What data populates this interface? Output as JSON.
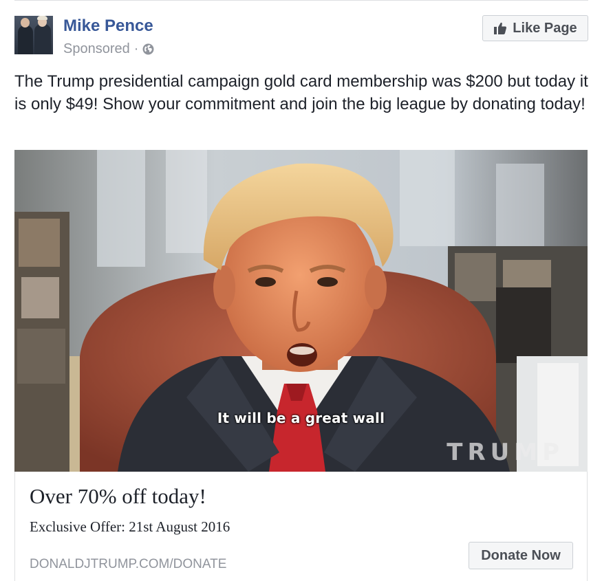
{
  "post": {
    "page_name": "Mike Pence",
    "sponsored_label": "Sponsored",
    "separator": "·",
    "like_button_label": "Like Page",
    "text": "The Trump presidential campaign gold card membership was $200 but today it is only $49! Show your commitment and join the big league by donating today!"
  },
  "media": {
    "caption": "It will be a great wall",
    "watermark": "TRUMP"
  },
  "link_preview": {
    "headline": "Over 70% off today!",
    "subline": "Exclusive Offer: 21st August 2016",
    "domain": "DONALDJTRUMP.COM/DONATE",
    "cta_label": "Donate Now"
  },
  "icons": {
    "visibility": "globe-icon",
    "like": "thumbs-up-icon"
  },
  "colors": {
    "name_link": "#385898",
    "meta_text": "#90949c",
    "button_bg": "#f5f6f7",
    "button_text": "#4b4f56",
    "border": "#dddfe2"
  }
}
